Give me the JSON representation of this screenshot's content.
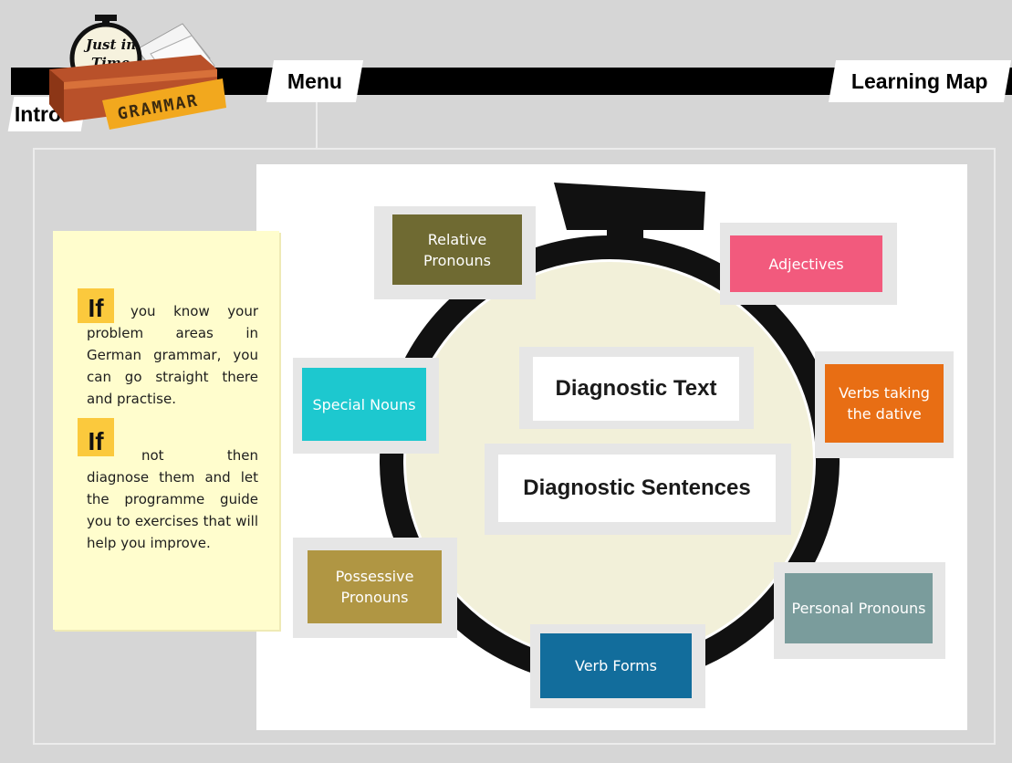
{
  "logo": {
    "line1": "Just in",
    "line2": "Time",
    "word": "GRAMMAR"
  },
  "nav": {
    "intro": "Intro",
    "menu": "Menu",
    "learning_map": "Learning Map"
  },
  "note": {
    "if_1": "If",
    "paragraph_1": "you know your problem areas in German grammar, you can go straight there and practise.",
    "if_2": "If",
    "paragraph_2": "not then diagnose them and let the programme guide you to exercises that will help you improve."
  },
  "diagnostics": {
    "text": "Diagnostic Text",
    "sentences": "Diagnostic Sentences"
  },
  "topics": {
    "relative_pronouns": "Relative Pronouns",
    "adjectives": "Adjectives",
    "special_nouns": "Special Nouns",
    "verbs_dative": "Verbs taking the dative",
    "possessive_pronouns": "Possessive Pronouns",
    "personal_pronouns": "Personal Pronouns",
    "verb_forms": "Verb Forms"
  },
  "colors": {
    "relative_pronouns": "#6f6a32",
    "adjectives": "#f25a7d",
    "special_nouns": "#1dc8cf",
    "verbs_dative": "#e86e14",
    "possessive_pronouns": "#b09643",
    "personal_pronouns": "#7a9c9c",
    "verb_forms": "#126d9c",
    "note_background": "#fffdcd",
    "note_highlight": "#fbc93d"
  }
}
